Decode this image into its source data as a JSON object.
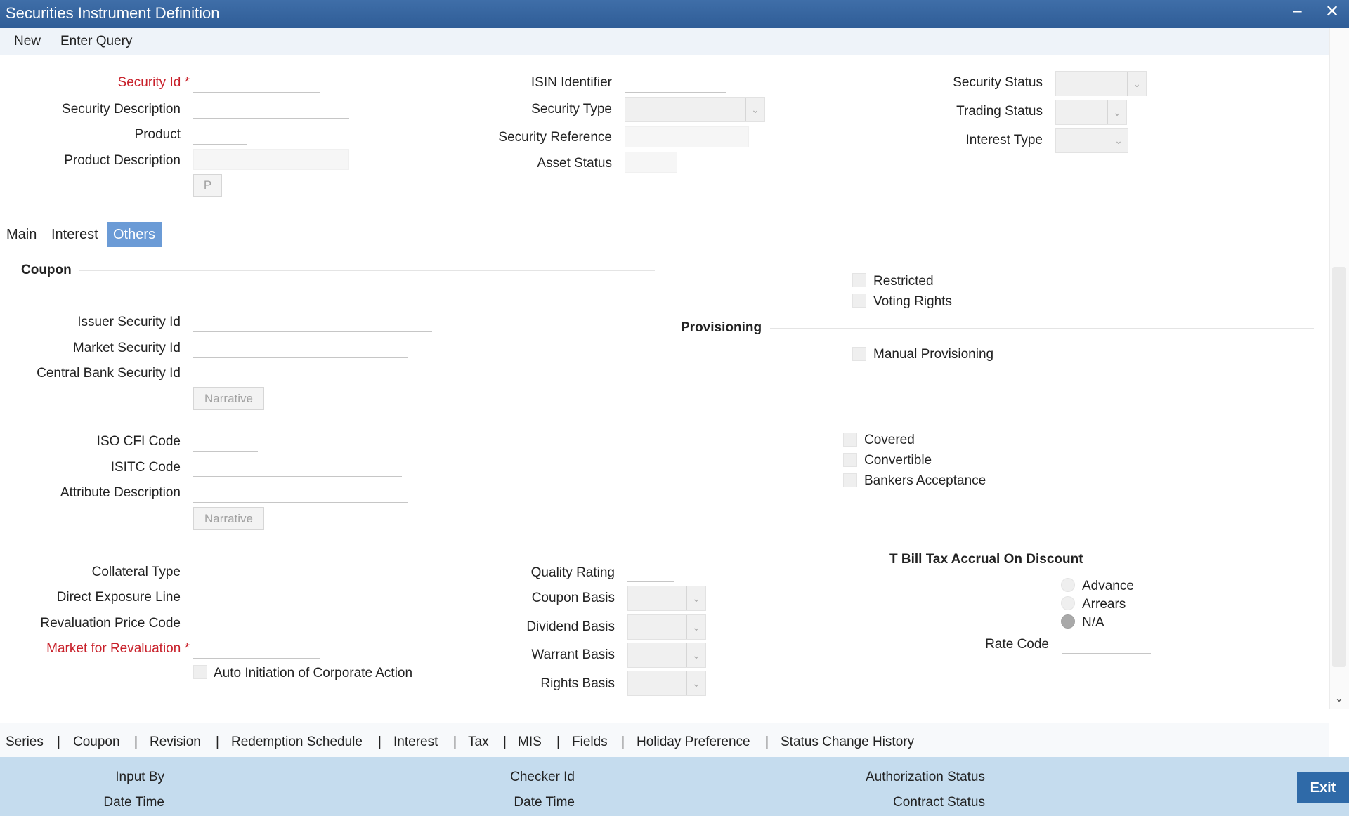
{
  "window": {
    "title": "Securities Instrument Definition",
    "minimize": "–",
    "close": "✕"
  },
  "menu": {
    "new": "New",
    "enter_query": "Enter Query"
  },
  "header": {
    "security_id": "Security Id",
    "required_mark": "*",
    "security_description": "Security Description",
    "product": "Product",
    "product_description": "Product Description",
    "p_button": "P",
    "isin_identifier": "ISIN Identifier",
    "security_type": "Security Type",
    "security_reference": "Security Reference",
    "asset_status": "Asset Status",
    "security_status": "Security Status",
    "trading_status": "Trading Status",
    "interest_type": "Interest Type"
  },
  "tabs": [
    {
      "label": "Main"
    },
    {
      "label": "Interest"
    },
    {
      "label": "Others"
    }
  ],
  "coupon": {
    "heading": "Coupon",
    "issuer_security_id": "Issuer Security Id",
    "market_security_id": "Market Security Id",
    "central_bank_security_id": "Central Bank Security Id",
    "narrative": "Narrative",
    "iso_cfi_code": "ISO CFI Code",
    "isitc_code": "ISITC Code",
    "attribute_description": "Attribute Description",
    "collateral_type": "Collateral Type",
    "direct_exposure_line": "Direct Exposure Line",
    "revaluation_price_code": "Revaluation Price Code",
    "market_for_revaluation": "Market for Revaluation",
    "auto_initiation": "Auto Initiation of Corporate Action"
  },
  "basis": {
    "quality_rating": "Quality Rating",
    "coupon_basis": "Coupon Basis",
    "dividend_basis": "Dividend Basis",
    "warrant_basis": "Warrant Basis",
    "rights_basis": "Rights Basis"
  },
  "flags": {
    "restricted": "Restricted",
    "voting_rights": "Voting Rights",
    "covered": "Covered",
    "convertible": "Convertible",
    "bankers_acceptance": "Bankers Acceptance"
  },
  "provisioning": {
    "heading": "Provisioning",
    "manual_provisioning": "Manual Provisioning"
  },
  "tbill": {
    "heading": "T Bill Tax Accrual On Discount",
    "advance": "Advance",
    "arrears": "Arrears",
    "na": "N/A",
    "selected": "N/A",
    "rate_code": "Rate Code"
  },
  "links": [
    "Series",
    "Coupon",
    "Revision",
    "Redemption Schedule",
    "Interest",
    "Tax",
    "MIS",
    "Fields",
    "Holiday Preference",
    "Status Change History"
  ],
  "link_separator": "|",
  "footer": {
    "input_by": "Input By",
    "date_time": "Date Time",
    "checker_id": "Checker Id",
    "authorization_status": "Authorization Status",
    "contract_status": "Contract Status",
    "exit": "Exit"
  },
  "colors": {
    "titlebar": "#2f5d97",
    "active_tab": "#6b9bd6",
    "required": "#c8202a",
    "footer": "#c5dcee",
    "exit": "#2f6aa8"
  }
}
